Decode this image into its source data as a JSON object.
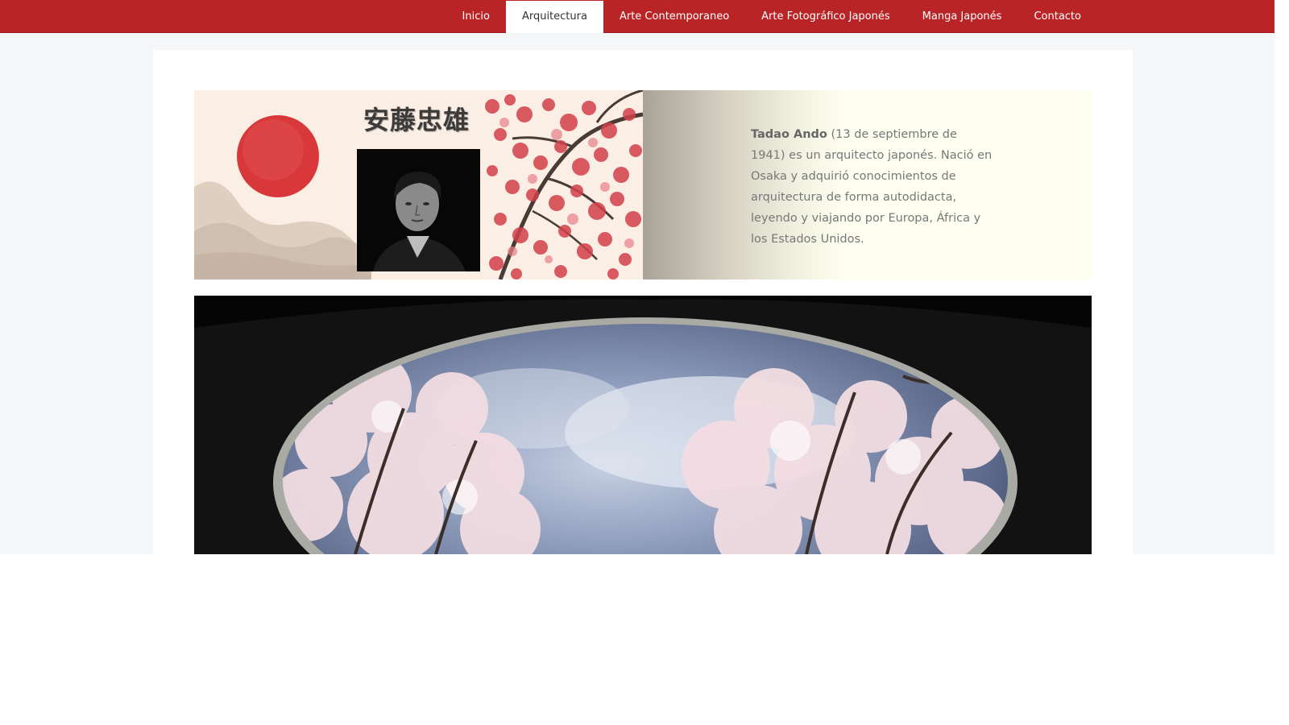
{
  "nav": {
    "items": [
      {
        "label": "Inicio",
        "active": false
      },
      {
        "label": "Arquitectura",
        "active": true
      },
      {
        "label": "Arte Contemporaneo",
        "active": false
      },
      {
        "label": "Arte Fotográfico Japonés",
        "active": false
      },
      {
        "label": "Manga Japonés",
        "active": false
      },
      {
        "label": "Contacto",
        "active": false
      }
    ]
  },
  "banner": {
    "kanji": "安藤忠雄",
    "bio_name": "Tadao Ando",
    "bio_text": " (13 de septiembre de 1941) es un arquitecto japonés. Nació en Osaka y adquirió conocimientos de arquitectura de forma autodidacta, leyendo y viajando por Europa, África y los Estados Unidos."
  },
  "colors": {
    "nav_bg": "#b92427",
    "sun": "#d9383a",
    "page_bg": "#f5f6f8"
  },
  "icons": {
    "portrait": "portrait-photo",
    "hero": "cherry-blossom-skylight-photo"
  }
}
